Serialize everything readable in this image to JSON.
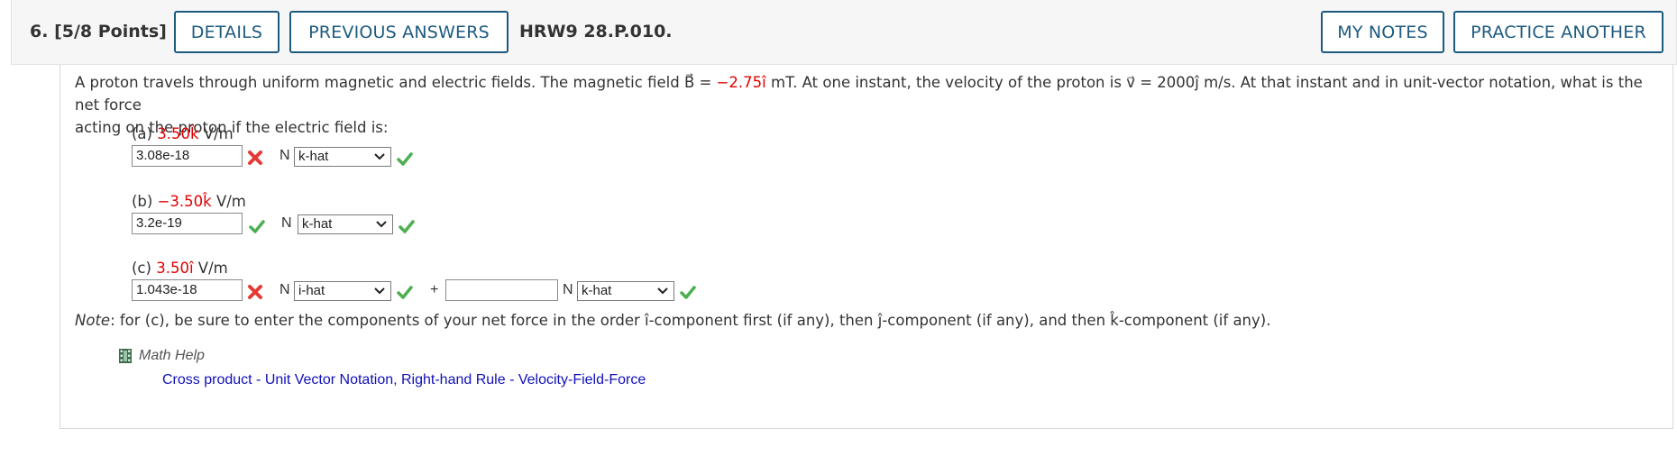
{
  "header": {
    "question_number": "6.",
    "points": "[5/8 Points]",
    "details_label": "DETAILS",
    "previous_answers_label": "PREVIOUS ANSWERS",
    "question_id": "HRW9 28.P.010.",
    "my_notes_label": "MY NOTES",
    "practice_another_label": "PRACTICE ANOTHER"
  },
  "problem": {
    "text_1": "A proton travels through uniform magnetic and electric fields. The magnetic field ",
    "B_symbol": "B⃗",
    "eq": " = ",
    "B_value": "−2.75î",
    "text_2": " mT. At one instant, the velocity of the proton is ",
    "v_symbol": "v⃗",
    "text_3": " = 2000ĵ m/s. At that instant and in unit-vector notation, what is the net force",
    "text_4": "acting on the proton if the electric field is:"
  },
  "parts": {
    "a": {
      "label_prefix": "(a) ",
      "value": "3.50k̂",
      "unit": " V/m",
      "answer": "3.08e-18",
      "answer_status": "incorrect",
      "unit_N": "N",
      "select": "k-hat",
      "select_status": "correct"
    },
    "b": {
      "label_prefix": "(b) ",
      "value": "−3.50k̂",
      "unit": " V/m",
      "answer": "3.2e-19",
      "answer_status": "correct",
      "unit_N": "N",
      "select": "k-hat",
      "select_status": "correct"
    },
    "c": {
      "label_prefix": "(c) ",
      "value": "3.50î",
      "unit": " V/m",
      "answer1": "1.043e-18",
      "answer1_status": "incorrect",
      "unit_N1": "N",
      "select1": "i-hat",
      "select1_status": "correct",
      "plus": "+",
      "answer2": "",
      "unit_N2": "N",
      "select2": "k-hat",
      "select2_status": "correct"
    }
  },
  "note": {
    "label": "Note",
    "text": ": for (c), be sure to enter the components of your net force in the order î-component first (if any), then ĵ-component (if any), and then k̂-component (if any)."
  },
  "math_help": {
    "label": "Math Help",
    "link1": "Cross product - Unit Vector Notation",
    "separator": ", ",
    "link2": "Right-hand Rule - Velocity-Field-Force"
  },
  "colors": {
    "button_border": "#1d5a7f",
    "highlight_red": "#e00000",
    "correct_green": "#4caf50",
    "incorrect_red": "#e53935",
    "link_blue": "#1010b8"
  },
  "icons": [
    "check-icon",
    "x-icon",
    "chevron-down-icon",
    "film-icon"
  ]
}
